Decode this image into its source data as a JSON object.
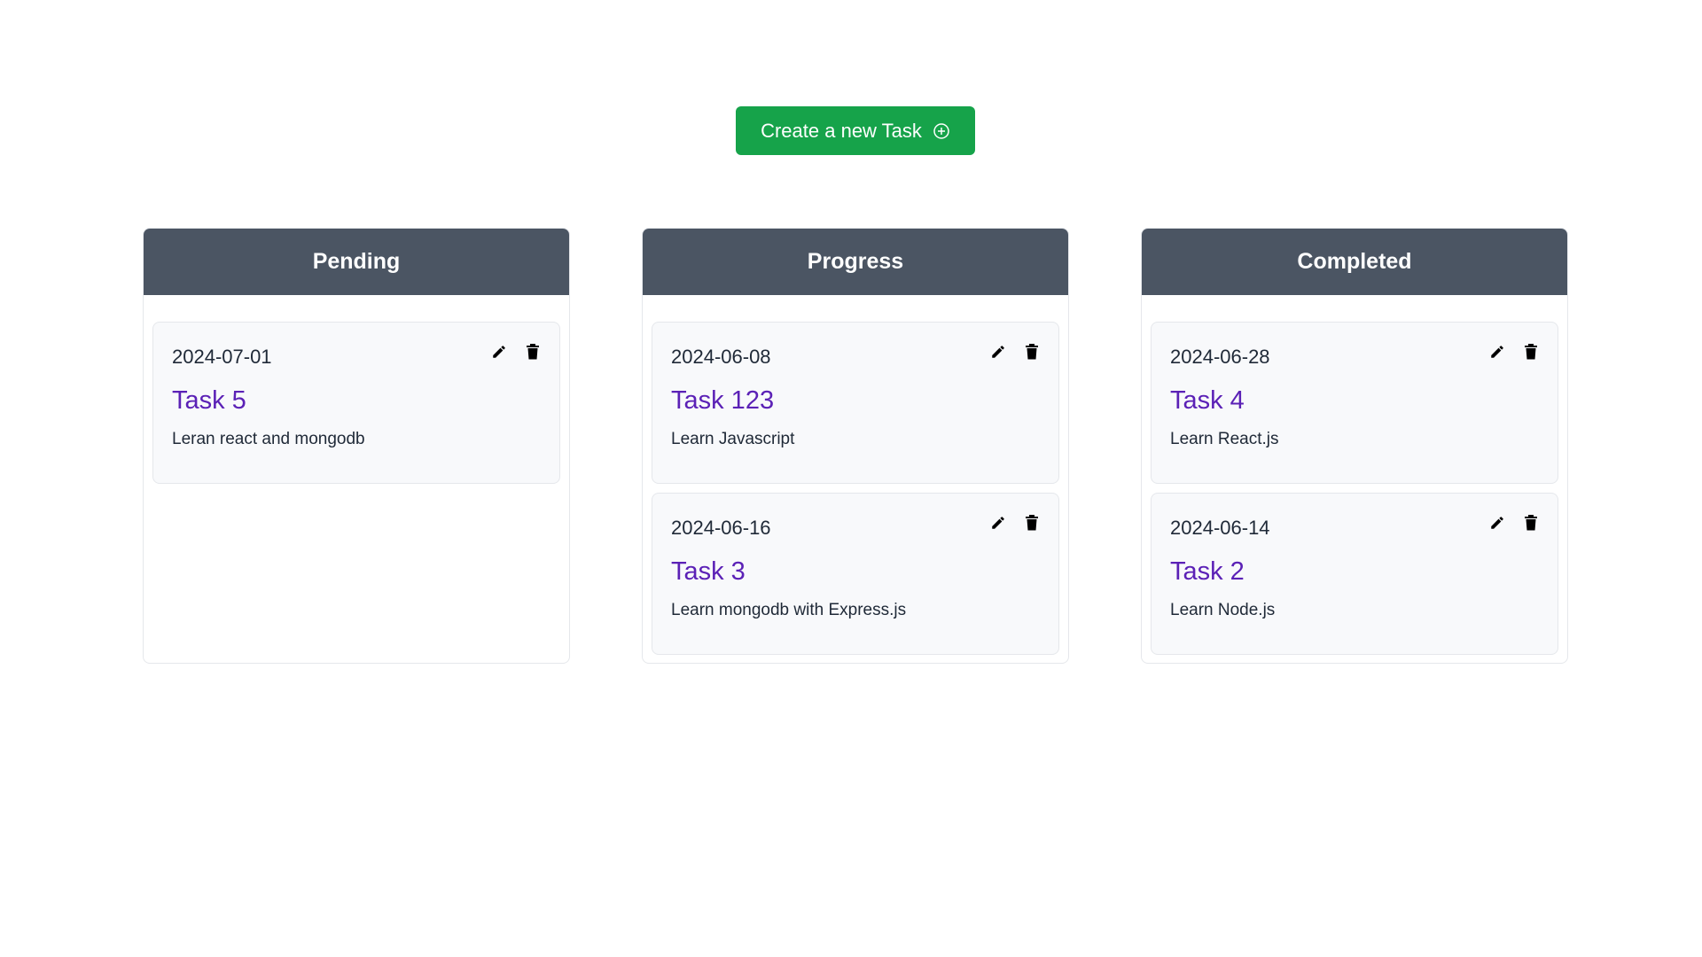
{
  "create_button": {
    "label": "Create a new Task",
    "icon": "plus-circle-icon",
    "color": "#16a34a"
  },
  "header_color": "#4b5563",
  "title_color": "#5b21b6",
  "columns": [
    {
      "title": "Pending",
      "tasks": [
        {
          "date": "2024-07-01",
          "title": "Task 5",
          "description": "Leran react and mongodb"
        }
      ]
    },
    {
      "title": "Progress",
      "tasks": [
        {
          "date": "2024-06-08",
          "title": "Task 123",
          "description": "Learn Javascript"
        },
        {
          "date": "2024-06-16",
          "title": "Task 3",
          "description": "Learn mongodb with Express.js"
        }
      ]
    },
    {
      "title": "Completed",
      "tasks": [
        {
          "date": "2024-06-28",
          "title": "Task 4",
          "description": "Learn React.js"
        },
        {
          "date": "2024-06-14",
          "title": "Task 2",
          "description": "Learn Node.js"
        }
      ]
    }
  ],
  "card_icons": {
    "edit": "pencil-icon",
    "delete": "trash-icon"
  }
}
